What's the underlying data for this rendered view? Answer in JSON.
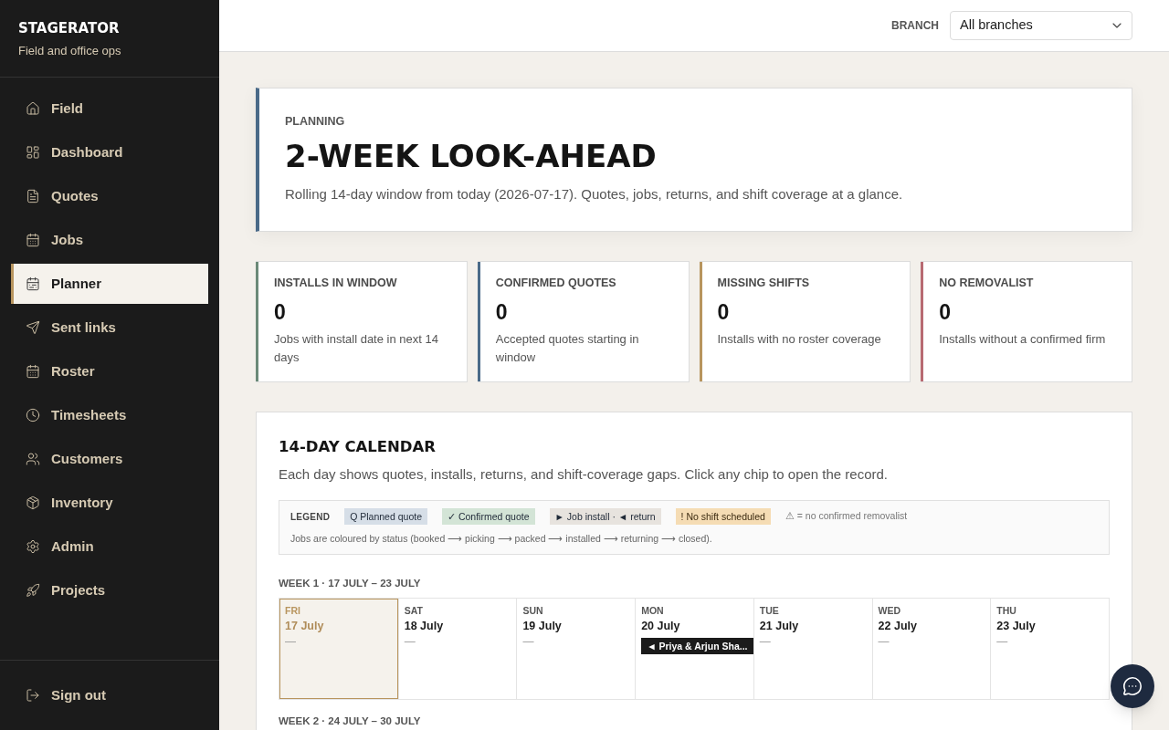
{
  "sidebar": {
    "brand": {
      "name": "STAGERATOR",
      "tagline": "Field and office ops"
    },
    "items": [
      {
        "label": "Field",
        "selected": false
      },
      {
        "label": "Dashboard",
        "selected": false
      },
      {
        "label": "Quotes",
        "selected": false
      },
      {
        "label": "Jobs",
        "selected": false
      },
      {
        "label": "Planner",
        "selected": true
      },
      {
        "label": "Sent links",
        "selected": false
      },
      {
        "label": "Roster",
        "selected": false
      },
      {
        "label": "Timesheets",
        "selected": false
      },
      {
        "label": "Customers",
        "selected": false
      },
      {
        "label": "Inventory",
        "selected": false
      },
      {
        "label": "Admin",
        "selected": false
      },
      {
        "label": "Projects",
        "selected": false
      }
    ],
    "footer_item": {
      "label": "Sign out"
    }
  },
  "header": {
    "branch_filter": {
      "label": "BRANCH",
      "value": "All branches"
    }
  },
  "page_header": {
    "eyebrow": "PLANNING",
    "title": "2-WEEK LOOK-AHEAD",
    "description": "Rolling 14-day window from today (2026-07-17). Quotes, jobs, returns, and shift coverage at a glance."
  },
  "kpis": [
    {
      "label": "INSTALLS IN WINDOW",
      "value": "0",
      "description": "Jobs with install date in next 14 days",
      "color": "#6b8a78"
    },
    {
      "label": "CONFIRMED QUOTES",
      "value": "0",
      "description": "Accepted quotes starting in window",
      "color": "#4a6a88"
    },
    {
      "label": "MISSING SHIFTS",
      "value": "0",
      "description": "Installs with no roster coverage",
      "color": "#b8955e"
    },
    {
      "label": "NO REMOVALIST",
      "value": "0",
      "description": "Installs without a confirmed firm",
      "color": "#b86a72"
    }
  ],
  "calendar": {
    "title": "14-DAY CALENDAR",
    "description": "Each day shows quotes, installs, returns, and shift-coverage gaps. Click any chip to open the record.",
    "legend": {
      "title": "LEGEND",
      "items": [
        {
          "kind": "quote_planned",
          "label": "Q Planned quote"
        },
        {
          "kind": "quote_confirmed",
          "label": "✓ Confirmed quote"
        },
        {
          "kind": "job",
          "label": "► Job install · ◄ return"
        },
        {
          "kind": "no_shift",
          "label": "! No shift scheduled"
        },
        {
          "kind": "note",
          "label": "⚠ = no confirmed removalist"
        }
      ],
      "footnote": "Jobs are coloured by status (booked ⟶ picking ⟶ packed ⟶ installed ⟶ returning ⟶ closed)."
    },
    "weeks": [
      {
        "label": "WEEK 1 · 17 JULY – 23 JULY",
        "days": [
          {
            "weekday": "FRI",
            "date": "17 July",
            "today": true,
            "empty_mark": "—"
          },
          {
            "weekday": "SAT",
            "date": "18 July",
            "today": false,
            "empty_mark": "—"
          },
          {
            "weekday": "SUN",
            "date": "19 July",
            "today": false,
            "empty_mark": "—"
          },
          {
            "weekday": "MON",
            "date": "20 July",
            "today": false,
            "entries": [
              {
                "kind": "job_return",
                "label": "◄ Priya & Arjun Sha..."
              }
            ]
          },
          {
            "weekday": "TUE",
            "date": "21 July",
            "today": false,
            "empty_mark": "—"
          },
          {
            "weekday": "WED",
            "date": "22 July",
            "today": false,
            "empty_mark": "—"
          },
          {
            "weekday": "THU",
            "date": "23 July",
            "today": false,
            "empty_mark": "—"
          }
        ]
      },
      {
        "label": "WEEK 2 · 24 JULY – 30 JULY"
      }
    ]
  }
}
